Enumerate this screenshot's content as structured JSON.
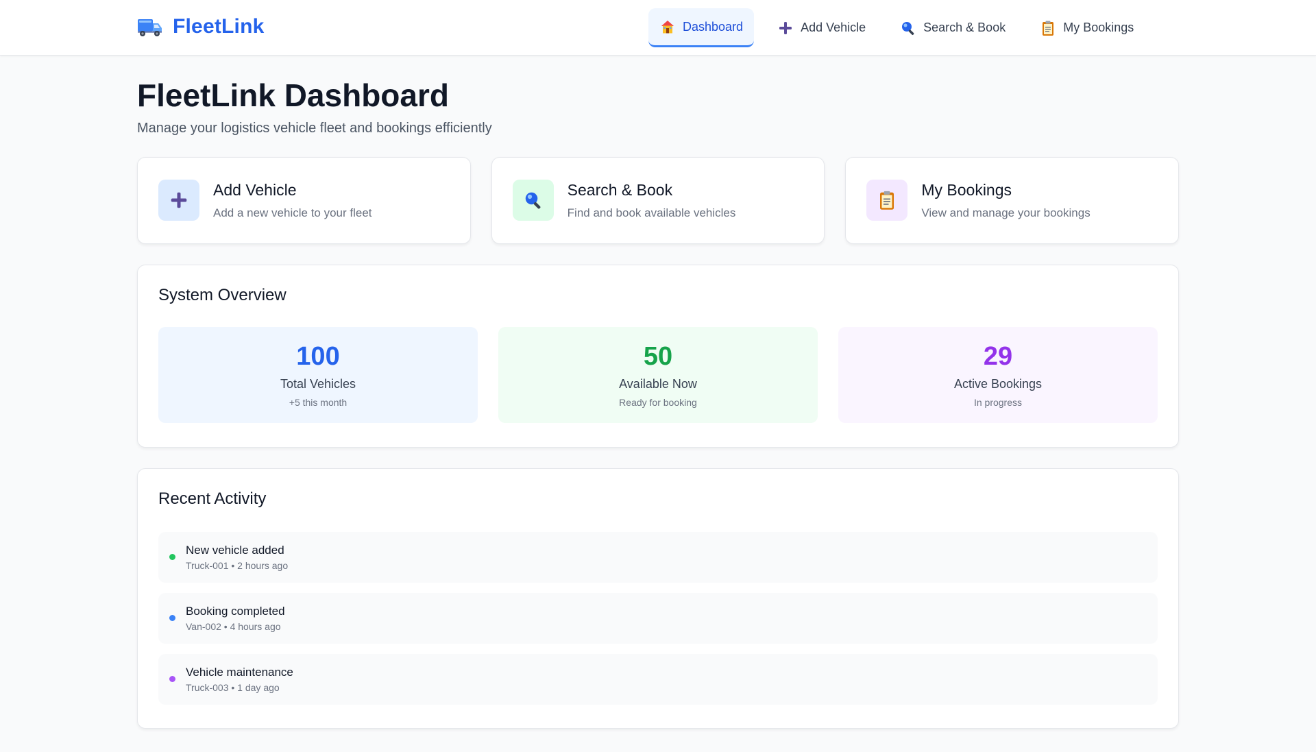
{
  "colors": {
    "brand": "#2563eb",
    "blue": "#2563eb",
    "green": "#16a34a",
    "purple": "#9333ea",
    "blue_bg": "#eff6ff",
    "green_bg": "#f0fdf4",
    "purple_bg": "#faf5ff"
  },
  "header": {
    "brand_name": "FleetLink",
    "brand_icon": "truck-icon",
    "nav": [
      {
        "label": "Dashboard",
        "icon": "house-icon",
        "active": true
      },
      {
        "label": "Add Vehicle",
        "icon": "plus-icon",
        "active": false
      },
      {
        "label": "Search & Book",
        "icon": "magnifier-icon",
        "active": false
      },
      {
        "label": "My Bookings",
        "icon": "clipboard-icon",
        "active": false
      }
    ]
  },
  "main": {
    "title": "FleetLink Dashboard",
    "subtitle": "Manage your logistics vehicle fleet and bookings efficiently",
    "actions": [
      {
        "title": "Add Vehicle",
        "description": "Add a new vehicle to your fleet",
        "icon": "plus-icon"
      },
      {
        "title": "Search & Book",
        "description": "Find and book available vehicles",
        "icon": "magnifier-icon"
      },
      {
        "title": "My Bookings",
        "description": "View and manage your bookings",
        "icon": "clipboard-icon"
      }
    ],
    "overview": {
      "title": "System Overview",
      "stats": [
        {
          "value": "100",
          "label": "Total Vehicles",
          "sub": "+5 this month"
        },
        {
          "value": "50",
          "label": "Available Now",
          "sub": "Ready for booking"
        },
        {
          "value": "29",
          "label": "Active Bookings",
          "sub": "In progress"
        }
      ]
    },
    "activity": {
      "title": "Recent Activity",
      "items": [
        {
          "title": "New vehicle added",
          "meta": "Truck-001 • 2 hours ago",
          "status_color": "#22c55e"
        },
        {
          "title": "Booking completed",
          "meta": "Van-002 • 4 hours ago",
          "status_color": "#3b82f6"
        },
        {
          "title": "Vehicle maintenance",
          "meta": "Truck-003 • 1 day ago",
          "status_color": "#a855f7"
        }
      ]
    }
  }
}
